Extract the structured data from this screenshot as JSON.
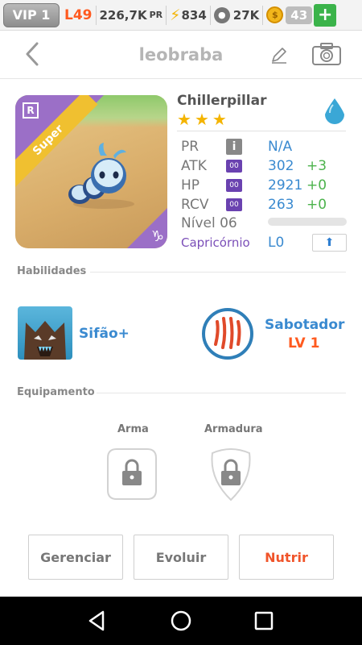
{
  "status": {
    "vip": "VIP 1",
    "level": "L49",
    "pr_value": "226,7K",
    "pr_unit": "PR",
    "energy": "834",
    "paws": "27K",
    "coins": "43",
    "plus": "+"
  },
  "header": {
    "title": "leobraba"
  },
  "monster": {
    "name": "Chillerpillar",
    "stars": 3,
    "rarity_badge": "R",
    "rarity_label": "Super",
    "stats": {
      "pr_label": "PR",
      "pr_info": "i",
      "pr_value": "N/A",
      "atk_label": "ATK",
      "atk_badge": "00",
      "atk_value": "302",
      "atk_bonus": "+3",
      "hp_label": "HP",
      "hp_badge": "00",
      "hp_value": "2921",
      "hp_bonus": "+0",
      "rcv_label": "RCV",
      "rcv_badge": "00",
      "rcv_value": "263",
      "rcv_bonus": "+0",
      "level_label": "Nível 06"
    },
    "zodiac": "Capricórnio",
    "zodiac_level": "L0"
  },
  "skills": {
    "title": "Habilidades",
    "active_name": "Sifão+",
    "passive_name": "Sabotador",
    "passive_level": "LV 1"
  },
  "equipment": {
    "title": "Equipamento",
    "weapon": "Arma",
    "armor": "Armadura"
  },
  "actions": {
    "manage": "Gerenciar",
    "evolve": "Evoluir",
    "feed": "Nutrir"
  },
  "colors": {
    "accent_blue": "#3a8ad0",
    "accent_orange": "#ff5a1f",
    "bonus_green": "#4cb34c",
    "rarity_purple": "#9b6fc7"
  }
}
